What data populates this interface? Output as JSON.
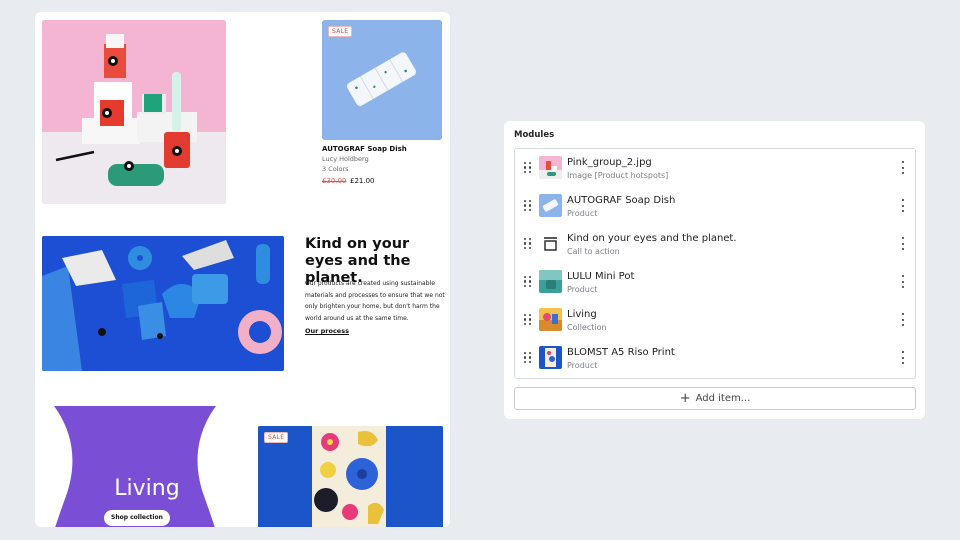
{
  "preview": {
    "sale_badge": "SALE",
    "product": {
      "name": "AUTOGRAF Soap Dish",
      "vendor": "Lucy Holdberg",
      "colors": "3 Colors",
      "old_price": "£30.00",
      "new_price": "£21.00"
    },
    "cta": {
      "title": "Kind on your eyes and the planet.",
      "body": "Our products are created using sustainable materials and processes to ensure that we not only brighten your home, but don't harm the world around us at the same time.",
      "link": "Our process"
    },
    "collection": {
      "title": "Living",
      "button": "Shop collection"
    },
    "print_sale_badge": "SALE"
  },
  "modules": {
    "title": "Modules",
    "items": [
      {
        "label": "Pink_group_2.jpg",
        "sub": "Image [Product hotspots]",
        "icon": "image-thumbnail"
      },
      {
        "label": "AUTOGRAF Soap Dish",
        "sub": "Product",
        "icon": "product-thumbnail"
      },
      {
        "label": "Kind on your eyes and the planet.",
        "sub": "Call to action",
        "icon": "call-to-action-icon"
      },
      {
        "label": "LULU Mini Pot",
        "sub": "Product",
        "icon": "product-thumbnail"
      },
      {
        "label": "Living",
        "sub": "Collection",
        "icon": "collection-thumbnail"
      },
      {
        "label": "BLOMST A5 Riso Print",
        "sub": "Product",
        "icon": "product-thumbnail"
      }
    ],
    "add_label": "Add item..."
  },
  "colors": {
    "background": "#e8ebf0",
    "living_purple": "#7a4fd6",
    "print_blue": "#1b55c8",
    "sale_red": "#d64545"
  }
}
